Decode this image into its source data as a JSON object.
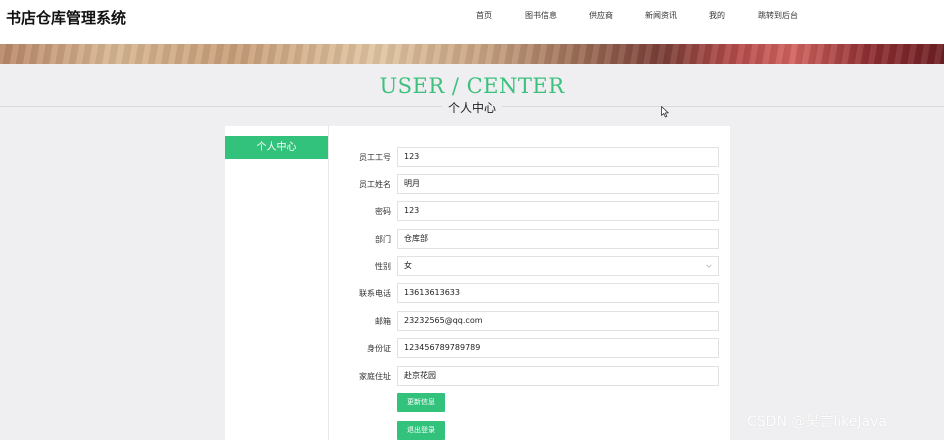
{
  "app": {
    "title": "书店仓库管理系统"
  },
  "nav": {
    "items": [
      "首页",
      "图书信息",
      "供应商",
      "新闻资讯",
      "我的",
      "跳转到后台"
    ]
  },
  "page": {
    "title_en": "USER / CENTER",
    "title_cn": "个人中心"
  },
  "sidebar": {
    "active_item": "个人中心"
  },
  "form": {
    "employee_id": {
      "label": "员工工号",
      "value": "123"
    },
    "employee_name": {
      "label": "员工姓名",
      "value": "明月"
    },
    "password": {
      "label": "密码",
      "value": "123"
    },
    "department": {
      "label": "部门",
      "value": "仓库部"
    },
    "gender": {
      "label": "性别",
      "value": "女"
    },
    "phone": {
      "label": "联系电话",
      "value": "13613613633"
    },
    "email": {
      "label": "邮箱",
      "value": "23232565@qq.com"
    },
    "id_card": {
      "label": "身份证",
      "value": "123456789789789"
    },
    "address": {
      "label": "家庭住址",
      "value": "赴京花园"
    },
    "update_button": "更新信息",
    "logout_button": "退出登录"
  },
  "watermark": "CSDN @昊言likeJava",
  "colors": {
    "accent": "#33c27c",
    "title_en": "#3cc07d"
  }
}
